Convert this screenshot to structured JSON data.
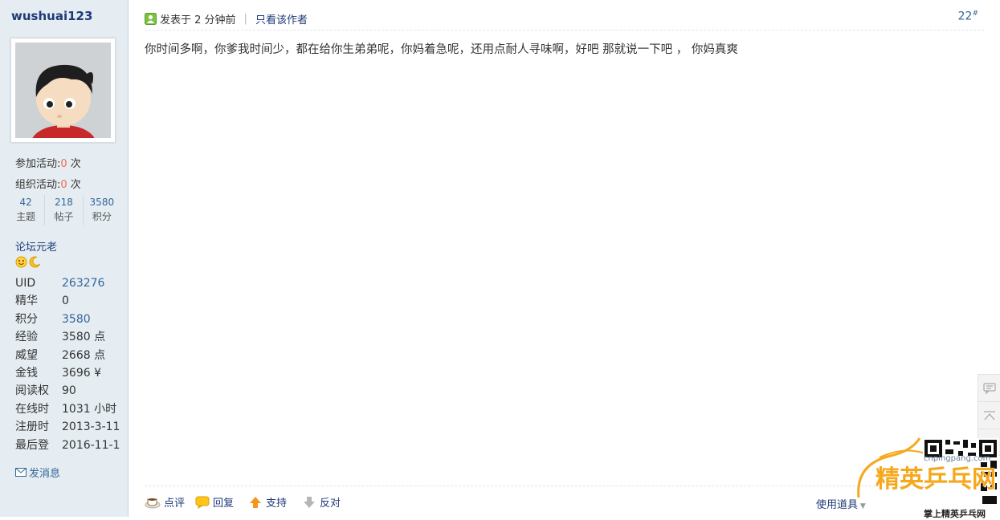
{
  "user": {
    "name": "wushuai123",
    "activities": [
      {
        "label": "参加活动:",
        "value": "0",
        "unit": " 次"
      },
      {
        "label": "组织活动:",
        "value": "0",
        "unit": " 次"
      }
    ],
    "stats": [
      {
        "value": "42",
        "label": "主题"
      },
      {
        "value": "218",
        "label": "帖子"
      },
      {
        "value": "3580",
        "label": "积分"
      }
    ],
    "group": "论坛元老",
    "profile": [
      {
        "key": "UID",
        "value": "263276"
      },
      {
        "key": "精华",
        "value": "0"
      },
      {
        "key": "积分",
        "value": "3580"
      },
      {
        "key": "经验",
        "value": "3580 点"
      },
      {
        "key": "威望",
        "value": "2668 点"
      },
      {
        "key": "金钱",
        "value": "3696 ¥"
      },
      {
        "key": "阅读权",
        "value": "90"
      },
      {
        "key": "在线时",
        "value": "1031 小时"
      },
      {
        "key": "注册时",
        "value": "2013-3-11"
      },
      {
        "key": "最后登",
        "value": "2016-11-1"
      }
    ],
    "send_message": "发消息"
  },
  "post": {
    "posted": "发表于 2 分钟前",
    "author_only": "只看该作者",
    "floor": "22",
    "floor_mark": "#",
    "content": "你时间多啊，你爹我时间少，都在给你生弟弟呢，你妈着急呢，还用点耐人寻味啊，好吧 那就说一下吧 ，  你妈真爽"
  },
  "actions": {
    "comment": "点评",
    "reply": "回复",
    "support": "支持",
    "oppose": "反对",
    "use_tools": "使用道具"
  },
  "watermark": {
    "brand": "精英乒乓网",
    "url": "cnpingpang.com",
    "tagline": "掌上精英乒乓网"
  },
  "colors": {
    "sidebar_bg": "#e5edf2",
    "link": "#336699",
    "highlight": "#f26c4f",
    "brand_orange": "#f6a81c"
  }
}
